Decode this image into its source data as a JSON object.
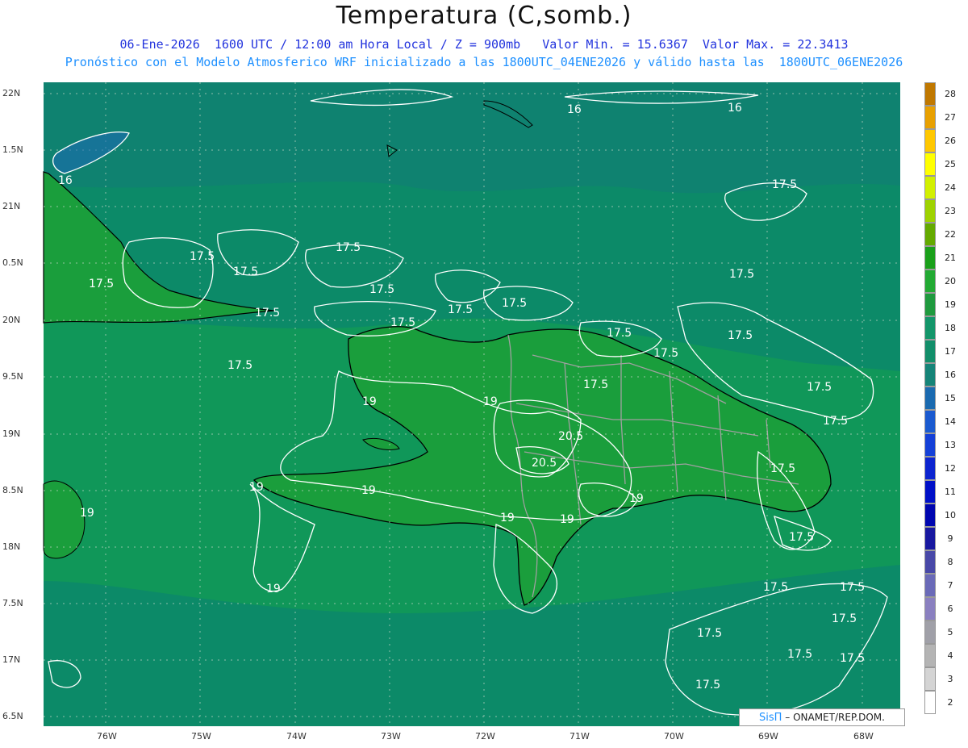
{
  "header": {
    "title": "Temperatura (C,somb.)",
    "subtitle_line1": "06-Ene-2026  1600 UTC / 12:00 am Hora Local / Z = 900mb   Valor Min. = 15.6367  Valor Max. = 22.3413",
    "subtitle_line2": "Pronóstico con el Modelo Atmosferico WRF inicializado a las 1800UTC_04ENE2026 y válido hasta las  1800UTC_06ENE2026"
  },
  "map": {
    "lat_labels": [
      "22N",
      "1.5N",
      "21N",
      "0.5N",
      "20N",
      "9.5N",
      "19N",
      "8.5N",
      "18N",
      "7.5N",
      "17N",
      "6.5N"
    ],
    "lon_labels": [
      "76W",
      "75W",
      "74W",
      "73W",
      "72W",
      "71W",
      "70W",
      "69W",
      "68W"
    ],
    "contour_labels": [
      "16",
      "16",
      "16",
      "17.5",
      "17.5",
      "17.5",
      "17.5",
      "17.5",
      "17.5",
      "17.5",
      "17.5",
      "17.5",
      "17.5",
      "17.5",
      "17.5",
      "17.5",
      "17.5",
      "17.5",
      "17.5",
      "17.5",
      "17.5",
      "17.5",
      "17.5",
      "19",
      "19",
      "19",
      "19",
      "19",
      "19",
      "19",
      "19",
      "19",
      "20.5",
      "20.5",
      "17.5",
      "17.5",
      "17.5",
      "17.5",
      "17.5",
      "17.5",
      "17.5"
    ],
    "colors": {
      "ocean": "#0c8a68",
      "land": "#1a9e3c",
      "contour": "#ffffff",
      "coast": "#000000",
      "borders": "#a0a0a0"
    }
  },
  "legend": {
    "labels": [
      "28",
      "27",
      "26",
      "25",
      "24",
      "23",
      "22",
      "21",
      "20",
      "19",
      "18",
      "17",
      "16",
      "15",
      "14",
      "13",
      "12",
      "11",
      "10",
      "9",
      "8",
      "7",
      "6",
      "5",
      "4",
      "3",
      "2"
    ],
    "colors": [
      "#c07800",
      "#e8a000",
      "#ffc800",
      "#ffff00",
      "#d2f000",
      "#9ed200",
      "#64aa00",
      "#1aa01a",
      "#22aa33",
      "#1f9a3e",
      "#13966a",
      "#128e6a",
      "#158478",
      "#1a6ab0",
      "#1a5ad0",
      "#1440d8",
      "#0c24d0",
      "#0010c8",
      "#0006b0",
      "#1818a0",
      "#4848a8",
      "#6a6ab8",
      "#8a80c0",
      "#a0a0a8",
      "#b4b4b4",
      "#d4d4d4",
      "#ffffff"
    ]
  },
  "credit": {
    "brand": "SisΠ",
    "text": " – ONAMET/REP.DOM."
  }
}
